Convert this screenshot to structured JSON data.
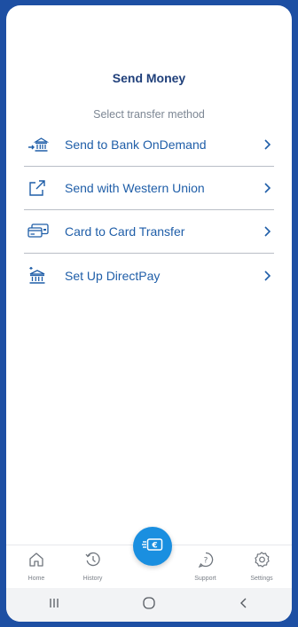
{
  "header": {
    "title": "Send Money"
  },
  "section": {
    "subtitle": "Select transfer method"
  },
  "menu": {
    "items": [
      {
        "label": "Send to Bank OnDemand",
        "icon": "bank-transfer-icon"
      },
      {
        "label": "Send with Western Union",
        "icon": "external-link-icon"
      },
      {
        "label": "Card to Card Transfer",
        "icon": "cards-icon"
      },
      {
        "label": "Set Up DirectPay",
        "icon": "bank-upload-icon"
      }
    ]
  },
  "bottom_nav": {
    "items": [
      {
        "label": "Home",
        "icon": "home-icon"
      },
      {
        "label": "History",
        "icon": "history-icon"
      },
      {
        "label": "Support",
        "icon": "support-icon"
      },
      {
        "label": "Settings",
        "icon": "settings-icon"
      }
    ],
    "center_button": {
      "icon": "send-euro-icon"
    }
  },
  "system_nav": {
    "buttons": [
      "recents-icon",
      "home-circle-icon",
      "back-icon"
    ]
  },
  "colors": {
    "background": "#1d4fa3",
    "accent": "#1a8fe0",
    "title": "#1f3f7a",
    "link": "#1f5ea8"
  }
}
